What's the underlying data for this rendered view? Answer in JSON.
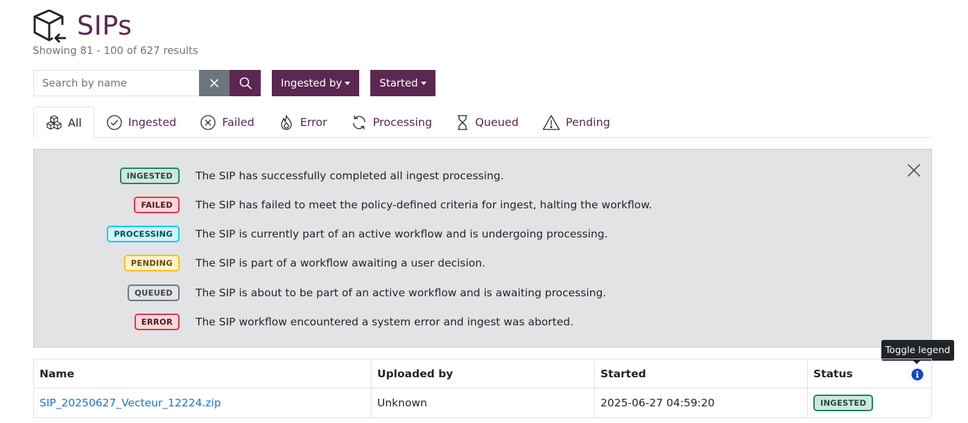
{
  "header": {
    "title": "SIPs",
    "subtitle": "Showing 81 - 100 of 627 results"
  },
  "toolbar": {
    "search_placeholder": "Search by name",
    "search_value": "",
    "ingested_by_label": "Ingested by",
    "started_label": "Started"
  },
  "tabs": [
    {
      "label": "All",
      "icon": "boxes-icon",
      "active": true
    },
    {
      "label": "Ingested",
      "icon": "check-circle-icon"
    },
    {
      "label": "Failed",
      "icon": "x-circle-icon"
    },
    {
      "label": "Error",
      "icon": "fire-icon"
    },
    {
      "label": "Processing",
      "icon": "refresh-icon"
    },
    {
      "label": "Queued",
      "icon": "hourglass-icon"
    },
    {
      "label": "Pending",
      "icon": "warning-triangle-icon"
    }
  ],
  "legend": {
    "items": [
      {
        "badge": "INGESTED",
        "text": "The SIP has successfully completed all ingest processing."
      },
      {
        "badge": "FAILED",
        "text": "The SIP has failed to meet the policy-defined criteria for ingest, halting the workflow."
      },
      {
        "badge": "PROCESSING",
        "text": "The SIP is currently part of an active workflow and is undergoing processing."
      },
      {
        "badge": "PENDING",
        "text": "The SIP is part of a workflow awaiting a user decision."
      },
      {
        "badge": "QUEUED",
        "text": "The SIP is about to be part of an active workflow and is awaiting processing."
      },
      {
        "badge": "ERROR",
        "text": "The SIP workflow encountered a system error and ingest was aborted."
      }
    ]
  },
  "tooltip": "Toggle legend",
  "table": {
    "columns": [
      "Name",
      "Uploaded by",
      "Started",
      "Status"
    ],
    "rows": [
      {
        "name": "SIP_20250627_Vecteur_12224.zip",
        "uploaded_by": "Unknown",
        "started": "2025-06-27 04:59:20",
        "status": "INGESTED"
      }
    ]
  },
  "colors": {
    "brand": "#5c2751",
    "link": "#1a73c9",
    "legend_bg": "#e2e3e5"
  }
}
